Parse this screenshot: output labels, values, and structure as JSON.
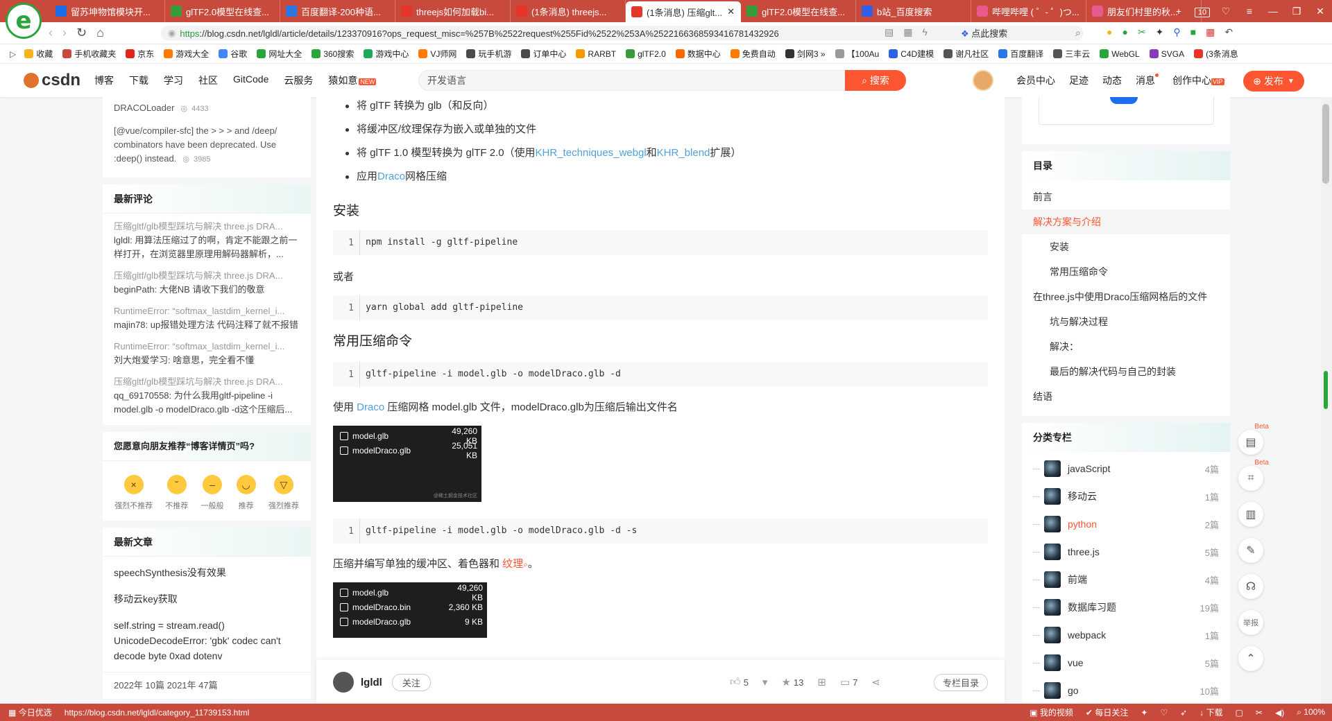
{
  "browser": {
    "logo_char": "e",
    "tabs": [
      {
        "icon": "x-icon",
        "color": "#1d6ae6",
        "label": "留苏坤物馆模块开..."
      },
      {
        "icon": "gltf-icon",
        "color": "#3a9b3a",
        "label": "glTF2.0模型在线查..."
      },
      {
        "icon": "translate-icon",
        "color": "#2c75e5",
        "label": "百度翻译-200种语..."
      },
      {
        "icon": "csdn-icon",
        "color": "#e6352b",
        "label": "threejs如何加载bi..."
      },
      {
        "icon": "csdn-icon",
        "color": "#e6352b",
        "label": "(1条消息) threejs..."
      },
      {
        "icon": "csdn-icon",
        "color": "#e6352b",
        "label": "(1条消息) 压缩glt...",
        "active": true
      },
      {
        "icon": "gltf-icon",
        "color": "#3a9b3a",
        "label": "glTF2.0模型在线查..."
      },
      {
        "icon": "baidu-icon",
        "color": "#2f61e6",
        "label": "b站_百度搜索"
      },
      {
        "icon": "bilibili-icon",
        "color": "#e75a8a",
        "label": "哔哩哔哩 ( ゜- ゜)つ..."
      },
      {
        "icon": "bilibili-icon",
        "color": "#e75a8a",
        "label": "朋友们村里的秋..."
      }
    ],
    "tab_count": "10",
    "url_scheme": "https",
    "url_rest": "://blog.csdn.net/lgldl/article/details/123370916?ops_request_misc=%257B%2522request%255Fid%2522%253A%2522166368593416781432926",
    "click_search": "点此搜索",
    "bookmarks": [
      {
        "label": "收藏",
        "color": "#f3b51b"
      },
      {
        "label": "手机收藏夹",
        "color": "#c84a3c"
      },
      {
        "label": "京东",
        "color": "#e1251b"
      },
      {
        "label": "游戏大全",
        "color": "#ff7a00"
      },
      {
        "label": "谷歌",
        "color": "#4285f4"
      },
      {
        "label": "网址大全",
        "color": "#2aa53b"
      },
      {
        "label": "360搜索",
        "color": "#2aa53b"
      },
      {
        "label": "游戏中心",
        "color": "#1fa95a"
      },
      {
        "label": "VJ师网",
        "color": "#ff7a00"
      },
      {
        "label": "玩手机游",
        "color": "#4a4a4a"
      },
      {
        "label": "订单中心",
        "color": "#4a4a4a"
      },
      {
        "label": "RARBT",
        "color": "#f39a00"
      },
      {
        "label": "glTF2.0",
        "color": "#3a9b3a"
      },
      {
        "label": "数据中心",
        "color": "#ff6600"
      },
      {
        "label": "免费自动",
        "color": "#ff7a00"
      },
      {
        "label": "剑网3 »",
        "color": "#333333"
      },
      {
        "label": "【100Au",
        "color": "#999999"
      },
      {
        "label": "C4D建模",
        "color": "#2f61e6"
      },
      {
        "label": "谢凡社区",
        "color": "#555555"
      },
      {
        "label": "百度翻译",
        "color": "#2c75e5"
      },
      {
        "label": "三丰云",
        "color": "#555555"
      },
      {
        "label": "WebGL",
        "color": "#2aa53b"
      },
      {
        "label": "SVGA",
        "color": "#8a3ab9"
      },
      {
        "label": "(3条消息",
        "color": "#e6352b"
      }
    ]
  },
  "csdn": {
    "logo": "csdn",
    "nav": [
      "博客",
      "下载",
      "学习",
      "社区",
      "GitCode",
      "云服务",
      "猿如意"
    ],
    "nav_hot": "NEW",
    "search_placeholder": "开发语言",
    "search_button": "搜索",
    "right_nav": [
      "会员中心",
      "足迹",
      "动态",
      "消息",
      "创作中心"
    ],
    "vip_badge": "VIP",
    "publish_button": "发布"
  },
  "left_sidebar": {
    "hot_items": [
      {
        "text": "DRACOLoader",
        "count": "4433"
      },
      {
        "text": "[@vue/compiler-sfc] the > > > and /deep/ combinators have been deprecated. Use :deep() instead.",
        "count": "3985"
      }
    ],
    "comments_title": "最新评论",
    "comments": [
      {
        "title": "压缩gltf/glb模型踩坑与解决 three.js DRA...",
        "body": "lgldl: 用算法压缩过了的啊，肯定不能跟之前一样打开，在浏览器里原理用解码器解析，..."
      },
      {
        "title": "压缩gltf/glb模型踩坑与解决 three.js DRA...",
        "body": "beginPath: 大佬NB 请收下我们的敬意"
      },
      {
        "title": "RuntimeError: “softmax_lastdim_kernel_i...",
        "body": "majin78: up报错处理方法 代码注释了就不报错"
      },
      {
        "title": "RuntimeError: “softmax_lastdim_kernel_i...",
        "body": "刘大炮爱学习: 啥意思，完全看不懂"
      },
      {
        "title": "压缩gltf/glb模型踩坑与解决 three.js DRA...",
        "body": "qq_69170558: 为什么我用gltf-pipeline -i model.glb -o modelDraco.glb -d这个压缩后..."
      }
    ],
    "recommend_title": "您愿意向朋友推荐“博客详情页”吗?",
    "emojis": [
      {
        "label": "强烈不推荐",
        "face": "×"
      },
      {
        "label": "不推荐",
        "face": "˘"
      },
      {
        "label": "一般般",
        "face": "–"
      },
      {
        "label": "推荐",
        "face": "◡"
      },
      {
        "label": "强烈推荐",
        "face": "▽"
      }
    ],
    "articles_title": "最新文章",
    "articles": [
      "speechSynthesis没有效果",
      "移动云key获取",
      "self.string = stream.read() UnicodeDecodeError: 'gbk' codec can't decode byte 0xad dotenv"
    ],
    "archive_partial": "2022年  10篇          2021年  47篇"
  },
  "article": {
    "bullets": [
      {
        "pre": "将 glTF 转换为 glb（和反向）",
        "link": "",
        "mid": "",
        "link2": "",
        "post": ""
      },
      {
        "pre": "将缓冲区/纹理保存为嵌入或单独的文件",
        "link": "",
        "mid": "",
        "link2": "",
        "post": ""
      },
      {
        "pre": "将 glTF 1.0 模型转换为 glTF 2.0（使用",
        "link": "KHR_techniques_webgl",
        "mid": "和",
        "link2": "KHR_blend",
        "post": "扩展）"
      },
      {
        "pre": "应用",
        "link": "Draco",
        "mid": "网格压缩",
        "link2": "",
        "post": ""
      }
    ],
    "h_install": "安装",
    "code_install": "npm install -g gltf-pipeline",
    "or_text": "或者",
    "code_yarn": "yarn global add gltf-pipeline",
    "h_commands": "常用压缩命令",
    "code_cmd1": "gltf-pipeline -i model.glb -o modelDraco.glb -d",
    "para1_pre": "使用 ",
    "para1_link": "Draco",
    "para1_post": " 压缩网格 model.glb 文件，modelDraco.glb为压缩后输出文件名",
    "term1": [
      {
        "name": "model.glb",
        "size": "49,260 KB"
      },
      {
        "name": "modelDraco.glb",
        "size": "25,051 KB"
      }
    ],
    "term1_watermark": "@稀土掘金技术社区",
    "code_cmd2": "gltf-pipeline -i model.glb -o modelDraco.glb -d -s",
    "para2_pre": "压缩并编写单独的缓冲区、着色器和 ",
    "para2_link": "纹理",
    "para2_post": "。",
    "term2": [
      {
        "name": "model.glb",
        "size": "49,260 KB"
      },
      {
        "name": "modelDraco.bin",
        "size": "2,360 KB"
      },
      {
        "name": "modelDraco.glb",
        "size": "9 KB"
      }
    ],
    "line_no": "1"
  },
  "article_bar": {
    "author": "lgldl",
    "follow": "关注",
    "likes": "5",
    "favorites": "13",
    "comments": "7",
    "directory": "专栏目录"
  },
  "toc": {
    "title": "目录",
    "items": [
      {
        "label": "前言",
        "level": 1
      },
      {
        "label": "解决方案与介绍",
        "level": 1,
        "active": true
      },
      {
        "label": "安装",
        "level": 2
      },
      {
        "label": "常用压缩命令",
        "level": 2
      },
      {
        "label": "在three.js中使用Draco压缩网格后的文件",
        "level": 1
      },
      {
        "label": "坑与解决过程",
        "level": 2
      },
      {
        "label": "解决：",
        "level": 2
      },
      {
        "label": "最后的解决代码与自己的封装",
        "level": 2
      },
      {
        "label": "结语",
        "level": 1
      }
    ]
  },
  "categories": {
    "title": "分类专栏",
    "items": [
      {
        "name": "javaScript",
        "count": "4篇"
      },
      {
        "name": "移动云",
        "count": "1篇"
      },
      {
        "name": "python",
        "count": "2篇",
        "active": true
      },
      {
        "name": "three.js",
        "count": "5篇"
      },
      {
        "name": "前端",
        "count": "4篇"
      },
      {
        "name": "数据库习题",
        "count": "19篇"
      },
      {
        "name": "webpack",
        "count": "1篇"
      },
      {
        "name": "vue",
        "count": "5篇"
      },
      {
        "name": "go",
        "count": "10篇"
      }
    ]
  },
  "toolbox": {
    "beta": "Beta",
    "report": "举报"
  },
  "status": {
    "left": "今日优选",
    "url": "https://blog.csdn.net/lgldl/category_11739153.html",
    "video": "我的视频",
    "daily": "每日关注",
    "download": "下载",
    "zoom": "100%"
  },
  "colors": {
    "browser_red": "#c84a3c",
    "csdn_red": "#fc5531",
    "link_blue": "#4ea1db"
  }
}
